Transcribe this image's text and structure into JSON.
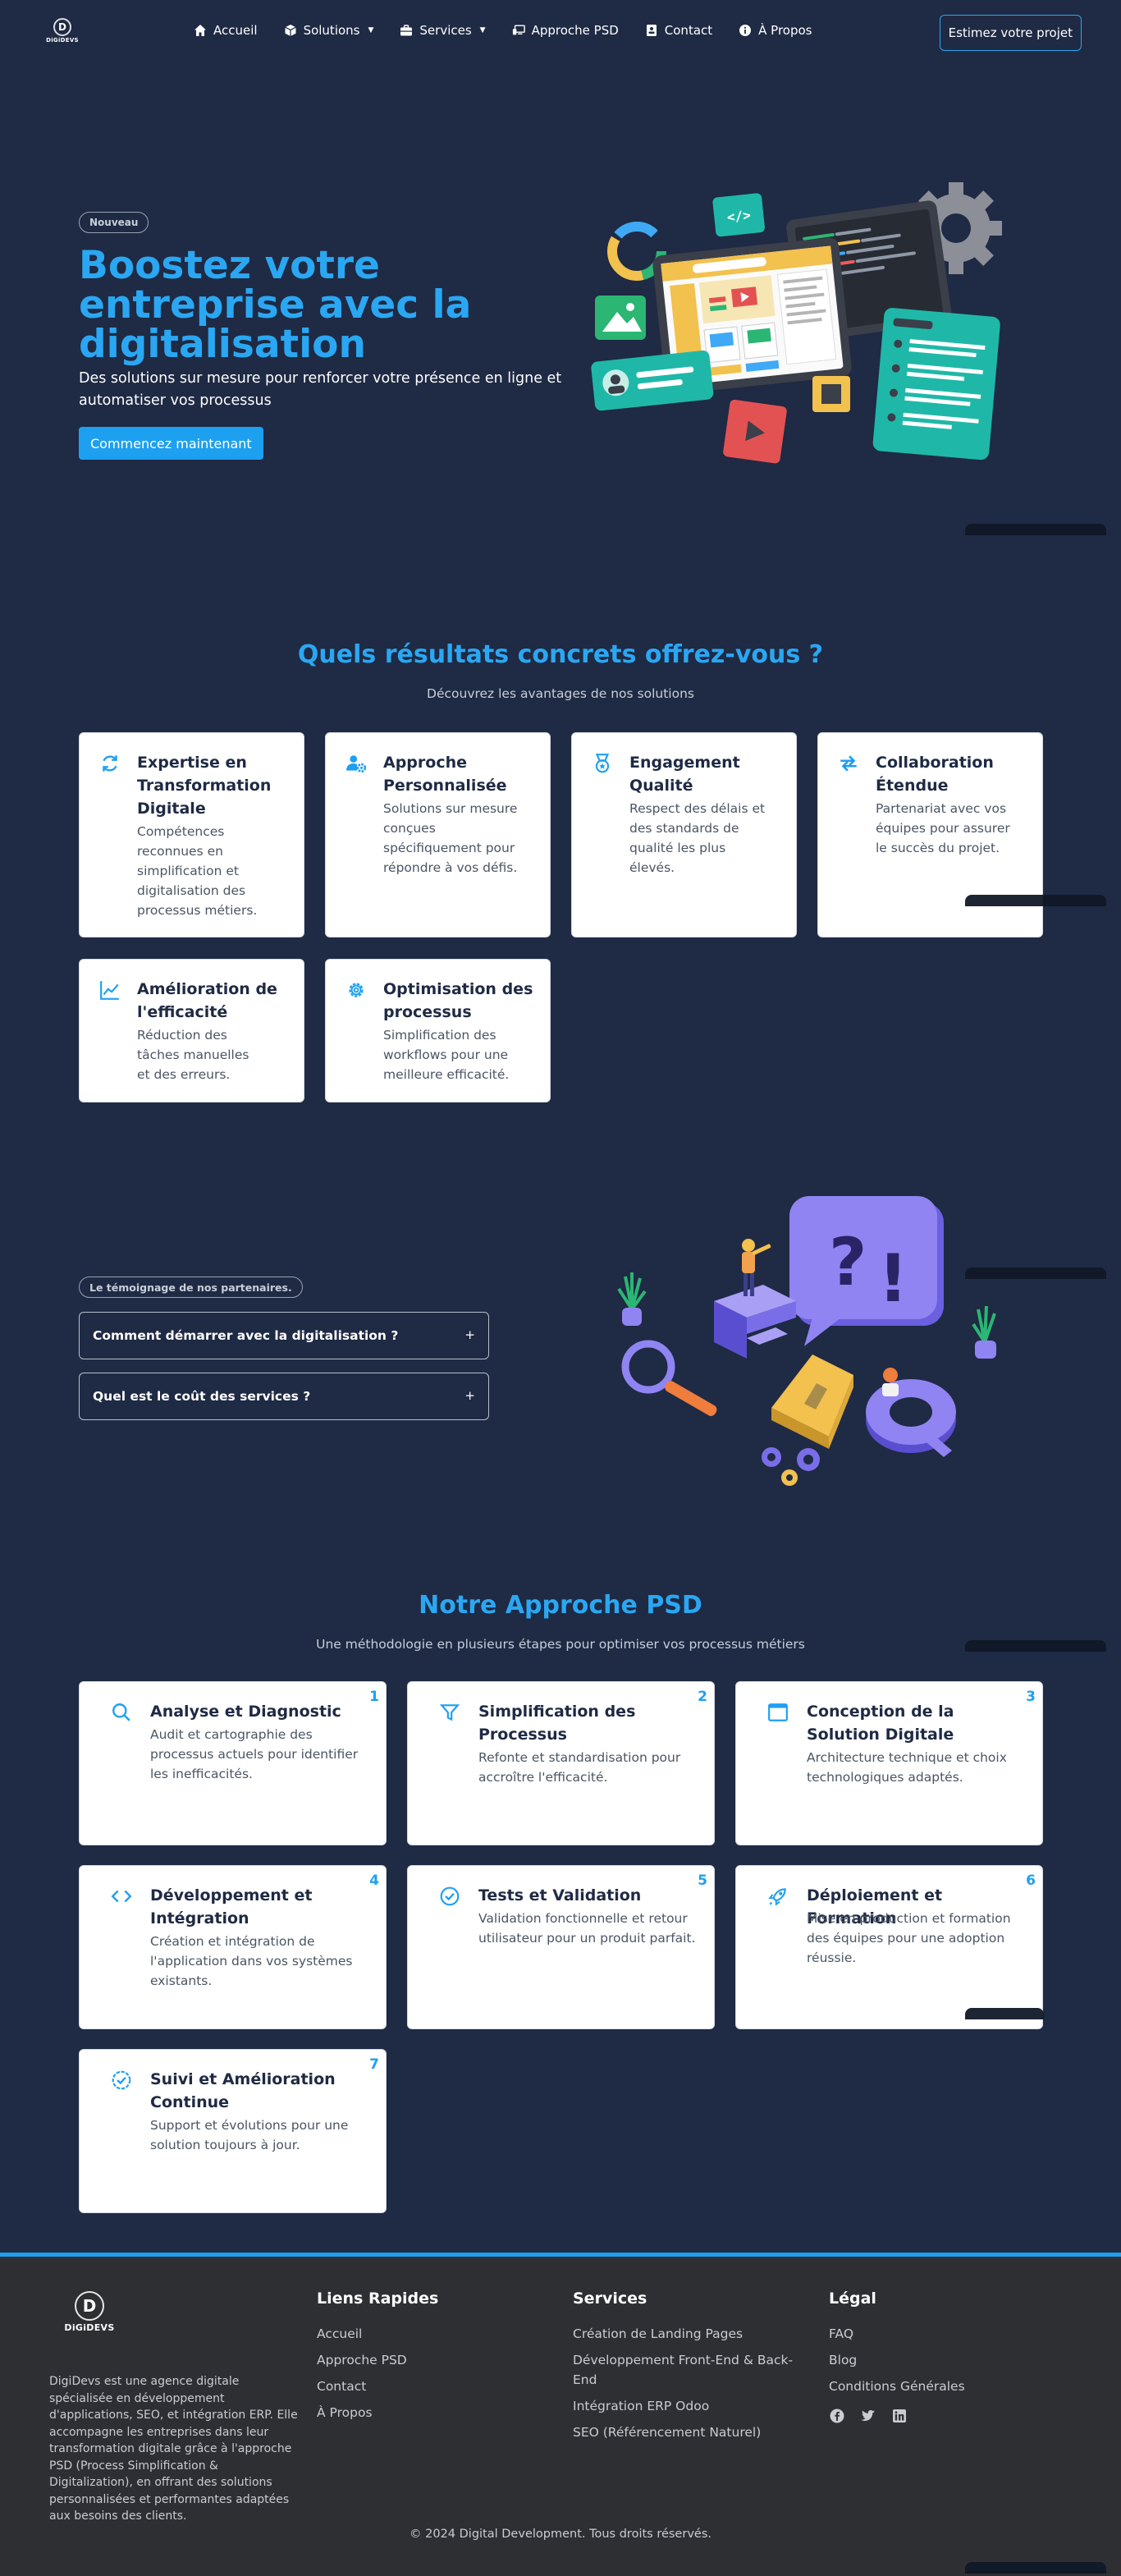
{
  "nav": {
    "logo_text": "DiGiDEVS",
    "links": [
      {
        "label": "Accueil",
        "icon": "home-icon"
      },
      {
        "label": "Solutions",
        "icon": "cube-icon",
        "dropdown": true
      },
      {
        "label": "Services",
        "icon": "briefcase-icon",
        "dropdown": true
      },
      {
        "label": "Approche PSD",
        "icon": "monitor-icon"
      },
      {
        "label": "Contact",
        "icon": "contact-card-icon"
      },
      {
        "label": "À Propos",
        "icon": "info-icon"
      }
    ],
    "cta_label": "Estimez votre projet"
  },
  "hero": {
    "badge": "Nouveau",
    "title": "Boostez votre entreprise avec la digitalisation",
    "subtitle": "Des solutions sur mesure pour renforcer votre présence en ligne et automatiser vos processus",
    "button": "Commencez maintenant"
  },
  "results": {
    "title": "Quels résultats concrets offrez-vous ?",
    "subtitle": "Découvrez les avantages de nos solutions",
    "cards": [
      {
        "title": "Expertise en Transformation Digitale",
        "desc": "Compétences reconnues en simplification et digitalisation des processus métiers.",
        "icon": "refresh-icon"
      },
      {
        "title": "Approche Personnalisée",
        "desc": "Solutions sur mesure conçues spécifiquement pour répondre à vos défis.",
        "icon": "user-gear-icon"
      },
      {
        "title": "Engagement Qualité",
        "desc": "Respect des délais et des standards de qualité les plus élevés.",
        "icon": "medal-icon"
      },
      {
        "title": "Collaboration Étendue",
        "desc": "Partenariat avec vos équipes pour assurer le succès du projet.",
        "icon": "exchange-icon"
      },
      {
        "title": "Amélioration de l'efficacité",
        "desc": "Réduction des tâches manuelles et des erreurs.",
        "icon": "chart-line-icon"
      },
      {
        "title": "Optimisation des processus",
        "desc": "Simplification des workflows pour une meilleure efficacité.",
        "icon": "gear-icon"
      }
    ]
  },
  "faq": {
    "badge": "Le témoignage de nos partenaires.",
    "items": [
      {
        "question": "Comment démarrer avec la digitalisation ?",
        "toggle": "+"
      },
      {
        "question": "Quel est le coût des services ?",
        "toggle": "+"
      }
    ]
  },
  "psd": {
    "title": "Notre Approche PSD",
    "subtitle": "Une méthodologie en plusieurs étapes pour optimiser vos processus métiers",
    "steps": [
      {
        "num": "1",
        "title": "Analyse et Diagnostic",
        "desc": "Audit et cartographie des processus actuels pour identifier les inefficacités.",
        "icon": "search-icon"
      },
      {
        "num": "2",
        "title": "Simplification des Processus",
        "desc": "Refonte et standardisation pour accroître l'efficacité.",
        "icon": "filter-icon"
      },
      {
        "num": "3",
        "title": "Conception de la Solution Digitale",
        "desc": "Architecture technique et choix technologiques adaptés.",
        "icon": "window-icon"
      },
      {
        "num": "4",
        "title": "Développement et Intégration",
        "desc": "Création et intégration de l'application dans vos systèmes existants.",
        "icon": "code-icon"
      },
      {
        "num": "5",
        "title": "Tests et Validation",
        "desc": "Validation fonctionnelle et retour utilisateur pour un produit parfait.",
        "icon": "check-circle-icon"
      },
      {
        "num": "6",
        "title": "Déploiement et Formation",
        "desc": "Mise en production et formation des équipes pour une adoption réussie.",
        "icon": "rocket-icon"
      },
      {
        "num": "7",
        "title": "Suivi et Amélioration Continue",
        "desc": "Support et évolutions pour une solution toujours à jour.",
        "icon": "badge-check-icon"
      }
    ]
  },
  "footer": {
    "logo_text": "DiGiDEVS",
    "about": "DigiDevs est une agence digitale spécialisée en développement d'applications, SEO, et intégration ERP. Elle accompagne les entreprises dans leur transformation digitale grâce à l'approche PSD (Process Simplification & Digitalization), en offrant des solutions personnalisées et performantes adaptées aux besoins des clients.",
    "quick_links": {
      "title": "Liens Rapides",
      "items": [
        "Accueil",
        "Approche PSD",
        "Contact",
        "À Propos"
      ]
    },
    "services": {
      "title": "Services",
      "items": [
        "Création de Landing Pages",
        "Développement Front-End & Back-End",
        "Intégration ERP Odoo",
        "SEO (Référencement Naturel)"
      ]
    },
    "legal": {
      "title": "Légal",
      "items": [
        "FAQ",
        "Blog",
        "Conditions Générales"
      ]
    },
    "social": [
      "facebook-icon",
      "twitter-icon",
      "linkedin-icon"
    ],
    "copyright": "© 2024 Digital Development. Tous droits réservés."
  },
  "colors": {
    "accent": "#1ea0f0",
    "background": "#1f2a44",
    "footer": "#2e2f33",
    "card": "#ffffff"
  }
}
